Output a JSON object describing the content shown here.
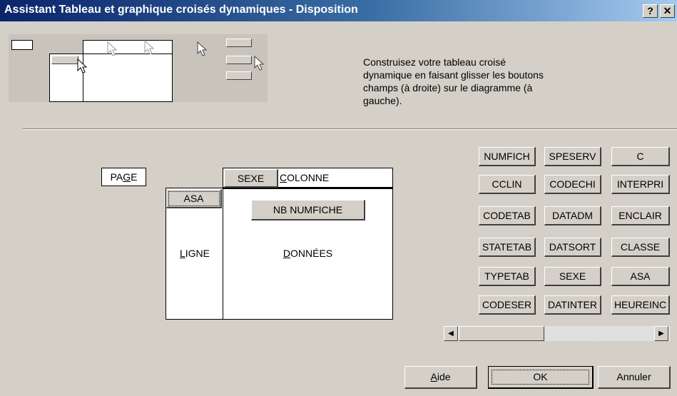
{
  "window": {
    "title": "Assistant Tableau et graphique croisés dynamiques - Disposition",
    "help_glyph": "?",
    "close_glyph": "✕"
  },
  "instructions": "Construisez votre tableau croisé dynamique en faisant glisser les boutons champs (à droite) sur le diagramme (à gauche).",
  "layout": {
    "page": {
      "pre": "PA",
      "key": "G",
      "post": "E"
    },
    "column_field": "SEXE",
    "column": {
      "pre": "",
      "key": "C",
      "post": "OLONNE"
    },
    "row_field": "ASA",
    "row": {
      "pre": "",
      "key": "L",
      "post": "IGNE"
    },
    "data_field": "NB NUMFICHE",
    "data": {
      "pre": "",
      "key": "D",
      "post": "ONNÉES"
    }
  },
  "fields": [
    [
      "NUMFICH",
      "SPESERV",
      "C"
    ],
    [
      "CCLIN",
      "CODECHI",
      "INTERPRI"
    ],
    [
      "CODETAB",
      "DATADM",
      "ENCLAIR"
    ],
    [
      "STATETAB",
      "DATSORT",
      "CLASSE"
    ],
    [
      "TYPETAB",
      "SEXE",
      "ASA"
    ],
    [
      "CODESER",
      "DATINTER",
      "HEUREINC"
    ]
  ],
  "scroll": {
    "left": "◀",
    "right": "▶"
  },
  "buttons": {
    "aide": {
      "pre": "",
      "key": "A",
      "post": "ide"
    },
    "ok": "OK",
    "annuler": "Annuler"
  }
}
